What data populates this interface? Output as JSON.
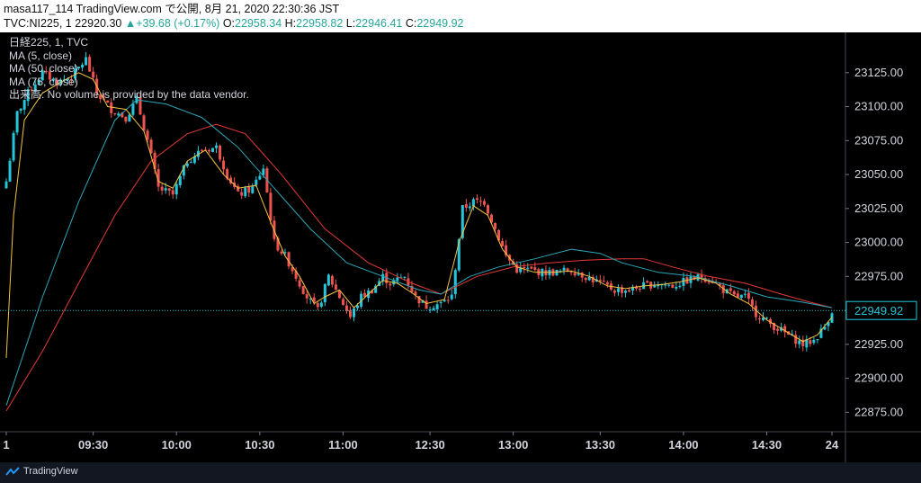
{
  "header": {
    "line1": "masa117_114 TradingView.com で公開, 8月 21, 2020 22:30:36 JST",
    "symbol": "TVC:NI225, 1",
    "last": "22920.30",
    "arrow": "▲",
    "change": "+39.68 (+0.17%)",
    "o_label": "O:",
    "o_val": "22958.34",
    "h_label": "H:",
    "h_val": "22958.82",
    "l_label": "L:",
    "l_val": "22946.41",
    "c_label": "C:",
    "c_val": "22949.92"
  },
  "legend": {
    "title": "日経225, 1, TVC",
    "ma5": "MA (5, close)",
    "ma50": "MA (50, close)",
    "ma75": "MA (75, close)",
    "volume": "出来高: No volume is provided by the data vendor."
  },
  "footer": {
    "brand": "TradingView"
  },
  "colors": {
    "background": "#000000",
    "up": "#26c6da",
    "down": "#ef5350",
    "ma5": "#f5c342",
    "ma50": "#2aa7b8",
    "ma75": "#e53935",
    "price_line": "#26c6da"
  },
  "chart_data": {
    "type": "candlestick",
    "symbol": "TVC:NI225",
    "interval": "1",
    "price_label": "22949.92",
    "y_ticks": [
      "23125.00",
      "23100.00",
      "23075.00",
      "23050.00",
      "23025.00",
      "23000.00",
      "22975.00",
      "22950.00",
      "22925.00",
      "22900.00",
      "22875.00"
    ],
    "x_ticks": [
      "1",
      "09:30",
      "10:00",
      "10:30",
      "11:00",
      "12:30",
      "13:00",
      "13:30",
      "14:00",
      "14:30",
      "24"
    ],
    "ylim": [
      22862,
      23152
    ],
    "close_path": [
      [
        0,
        23045
      ],
      [
        3,
        23095
      ],
      [
        6,
        23110
      ],
      [
        10,
        23125
      ],
      [
        14,
        23118
      ],
      [
        18,
        23122
      ],
      [
        22,
        23135
      ],
      [
        25,
        23110
      ],
      [
        29,
        23098
      ],
      [
        33,
        23092
      ],
      [
        36,
        23105
      ],
      [
        39,
        23075
      ],
      [
        42,
        23040
      ],
      [
        46,
        23035
      ],
      [
        50,
        23060
      ],
      [
        54,
        23068
      ],
      [
        58,
        23070
      ],
      [
        61,
        23050
      ],
      [
        64,
        23035
      ],
      [
        68,
        23040
      ],
      [
        71,
        23055
      ],
      [
        74,
        23000
      ],
      [
        77,
        22990
      ],
      [
        80,
        22975
      ],
      [
        83,
        22960
      ],
      [
        86,
        22950
      ],
      [
        89,
        22975
      ],
      [
        92,
        22960
      ],
      [
        95,
        22945
      ],
      [
        98,
        22960
      ],
      [
        101,
        22965
      ],
      [
        104,
        22975
      ],
      [
        106,
        22970
      ],
      [
        110,
        22975
      ],
      [
        113,
        22960
      ],
      [
        116,
        22953
      ],
      [
        120,
        22955
      ],
      [
        123,
        22960
      ],
      [
        126,
        23025
      ],
      [
        129,
        23030
      ],
      [
        132,
        23030
      ],
      [
        135,
        23010
      ],
      [
        138,
        22990
      ],
      [
        141,
        22980
      ],
      [
        144,
        22980
      ],
      [
        148,
        22978
      ],
      [
        152,
        22978
      ],
      [
        156,
        22980
      ],
      [
        160,
        22975
      ],
      [
        164,
        22970
      ],
      [
        168,
        22965
      ],
      [
        172,
        22965
      ],
      [
        176,
        22968
      ],
      [
        180,
        22970
      ],
      [
        184,
        22968
      ],
      [
        188,
        22972
      ],
      [
        192,
        22975
      ],
      [
        195,
        22972
      ],
      [
        198,
        22965
      ],
      [
        201,
        22960
      ],
      [
        204,
        22960
      ],
      [
        207,
        22948
      ],
      [
        211,
        22940
      ],
      [
        214,
        22935
      ],
      [
        217,
        22930
      ],
      [
        220,
        22925
      ],
      [
        223,
        22928
      ],
      [
        226,
        22938
      ],
      [
        228,
        22949.92
      ]
    ],
    "ma5": [
      [
        0,
        22915
      ],
      [
        2,
        23020
      ],
      [
        5,
        23090
      ],
      [
        10,
        23110
      ],
      [
        15,
        23118
      ],
      [
        20,
        23125
      ],
      [
        24,
        23120
      ],
      [
        28,
        23100
      ],
      [
        33,
        23098
      ],
      [
        38,
        23082
      ],
      [
        42,
        23045
      ],
      [
        46,
        23040
      ],
      [
        50,
        23060
      ],
      [
        55,
        23068
      ],
      [
        60,
        23050
      ],
      [
        64,
        23040
      ],
      [
        69,
        23042
      ],
      [
        73,
        23015
      ],
      [
        77,
        22990
      ],
      [
        81,
        22975
      ],
      [
        85,
        22955
      ],
      [
        88,
        22960
      ],
      [
        92,
        22965
      ],
      [
        96,
        22952
      ],
      [
        100,
        22962
      ],
      [
        104,
        22972
      ],
      [
        108,
        22970
      ],
      [
        112,
        22963
      ],
      [
        116,
        22955
      ],
      [
        121,
        22958
      ],
      [
        125,
        23000
      ],
      [
        129,
        23027
      ],
      [
        133,
        23020
      ],
      [
        137,
        22995
      ],
      [
        141,
        22982
      ],
      [
        146,
        22978
      ],
      [
        151,
        22978
      ],
      [
        156,
        22979
      ],
      [
        161,
        22975
      ],
      [
        166,
        22968
      ],
      [
        171,
        22966
      ],
      [
        176,
        22968
      ],
      [
        181,
        22969
      ],
      [
        186,
        22971
      ],
      [
        191,
        22974
      ],
      [
        196,
        22970
      ],
      [
        200,
        22962
      ],
      [
        205,
        22955
      ],
      [
        210,
        22943
      ],
      [
        215,
        22935
      ],
      [
        220,
        22927
      ],
      [
        224,
        22932
      ],
      [
        228,
        22945
      ]
    ],
    "ma50": [
      [
        0,
        22880
      ],
      [
        10,
        22960
      ],
      [
        20,
        23030
      ],
      [
        30,
        23090
      ],
      [
        36,
        23105
      ],
      [
        44,
        23102
      ],
      [
        54,
        23092
      ],
      [
        64,
        23070
      ],
      [
        74,
        23040
      ],
      [
        84,
        23010
      ],
      [
        94,
        22985
      ],
      [
        104,
        22975
      ],
      [
        114,
        22965
      ],
      [
        120,
        22962
      ],
      [
        128,
        22975
      ],
      [
        136,
        22982
      ],
      [
        146,
        22988
      ],
      [
        156,
        22995
      ],
      [
        164,
        22992
      ],
      [
        170,
        22985
      ],
      [
        180,
        22978
      ],
      [
        190,
        22975
      ],
      [
        200,
        22968
      ],
      [
        210,
        22960
      ],
      [
        220,
        22956
      ],
      [
        228,
        22952
      ]
    ],
    "ma75": [
      [
        0,
        22876
      ],
      [
        10,
        22920
      ],
      [
        20,
        22970
      ],
      [
        30,
        23020
      ],
      [
        40,
        23060
      ],
      [
        50,
        23080
      ],
      [
        58,
        23087
      ],
      [
        66,
        23080
      ],
      [
        76,
        23050
      ],
      [
        88,
        23010
      ],
      [
        100,
        22985
      ],
      [
        112,
        22970
      ],
      [
        120,
        22962
      ],
      [
        130,
        22975
      ],
      [
        140,
        22982
      ],
      [
        150,
        22985
      ],
      [
        160,
        22987
      ],
      [
        170,
        22988
      ],
      [
        176,
        22988
      ],
      [
        184,
        22982
      ],
      [
        194,
        22975
      ],
      [
        204,
        22970
      ],
      [
        214,
        22962
      ],
      [
        222,
        22956
      ],
      [
        228,
        22952
      ]
    ]
  }
}
